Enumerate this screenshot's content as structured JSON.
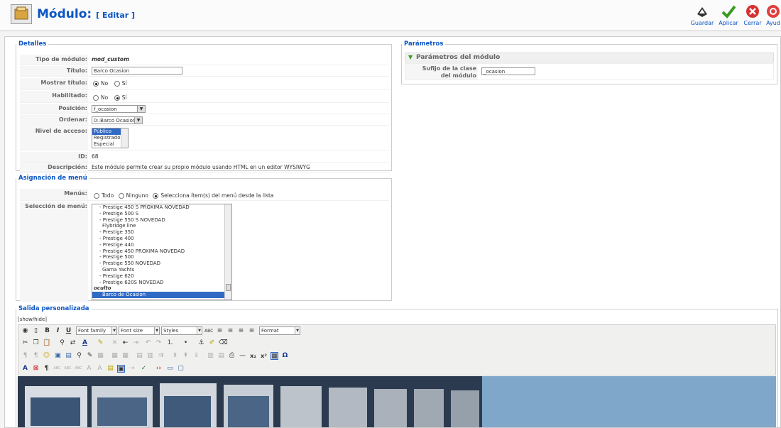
{
  "header": {
    "title": "Módulo:",
    "subtitle": "[ Editar ]",
    "buttons": [
      {
        "label": "Guardar",
        "icon": "save-icon"
      },
      {
        "label": "Aplicar",
        "icon": "apply-icon"
      },
      {
        "label": "Cerrar",
        "icon": "close-icon"
      },
      {
        "label": "Ayud",
        "icon": "help-icon"
      }
    ]
  },
  "details": {
    "legend": "Detalles",
    "tipo_label": "Tipo de módulo:",
    "tipo_value": "mod_custom",
    "titulo_label": "Título:",
    "titulo_value": "Barco Ocasion",
    "mostrar_label": "Mostrar título:",
    "mostrar_no": "No",
    "mostrar_si": "Sí",
    "habilitado_label": "Habilitado:",
    "habilitado_no": "No",
    "habilitado_si": "Sí",
    "posicion_label": "Posición:",
    "posicion_value": "f_ocasion",
    "ordenar_label": "Ordenar:",
    "ordenar_value": "0::Barco Ocasion",
    "nivel_label": "Nivel de acceso:",
    "nivel_options": [
      "Público",
      "Registrado",
      "Especial"
    ],
    "nivel_selected": "Público",
    "id_label": "ID:",
    "id_value": "68",
    "desc_label": "Descripción:",
    "desc_value": "Este módulo permite crear su propio módulo usando HTML en un editor WYSIWYG"
  },
  "params": {
    "legend": "Parámetros",
    "section": "Parámetros del módulo",
    "sufijo_label": "Sufijo de la clase del módulo",
    "sufijo_value": "_ocasion"
  },
  "menu": {
    "legend": "Asignación de menú",
    "menus_label": "Menús:",
    "opt_todo": "Todo",
    "opt_ninguno": "Ninguno",
    "opt_selecciona": "Selecciona ítem(s) del menú desde la lista",
    "seleccion_label": "Selección de menú:",
    "items": [
      " - Prestige 450 S PROXIMA NOVEDAD",
      " - Prestige 500 S",
      " - Prestige 550 S NOVEDAD",
      "Flybridge line",
      " - Prestige 350",
      " - Prestige 400",
      " - Prestige 440",
      " - Prestige 450 PROXIMA NOVEDAD",
      " - Prestige 500",
      " - Prestige 550 NOVEDAD",
      "Gama Yachts",
      " - Prestige 620",
      " - Prestige 620S NOVEDAD",
      "oculto",
      "Barco de Ocasion"
    ]
  },
  "output": {
    "legend": "Salida personalizada",
    "toggle": "[show/hide]",
    "font_family": "Font family",
    "font_size": "Font size",
    "styles": "Styles",
    "format": "Format"
  }
}
